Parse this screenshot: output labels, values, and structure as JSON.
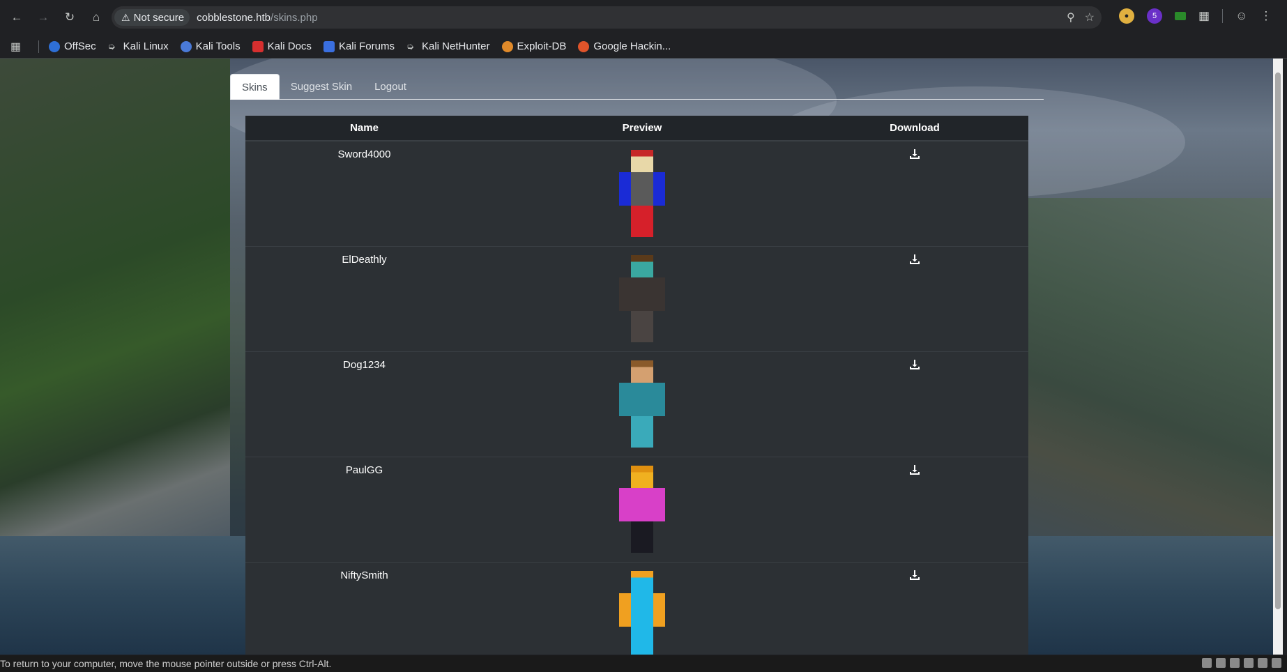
{
  "browser": {
    "security_label": "Not secure",
    "url_host": "cobblestone.htb",
    "url_path": "/skins.php",
    "extension_badge": "5"
  },
  "bookmarks": [
    {
      "label": "OffSec",
      "color": "#2e6fd6"
    },
    {
      "label": "Kali Linux",
      "color": "#c4c7c5"
    },
    {
      "label": "Kali Tools",
      "color": "#4a7ad8"
    },
    {
      "label": "Kali Docs",
      "color": "#d62f2f"
    },
    {
      "label": "Kali Forums",
      "color": "#3a6fe0"
    },
    {
      "label": "Kali NetHunter",
      "color": "#c4c7c5"
    },
    {
      "label": "Exploit-DB",
      "color": "#e08a2a"
    },
    {
      "label": "Google Hackin...",
      "color": "#e0542a"
    }
  ],
  "page": {
    "tabs": [
      {
        "label": "Skins",
        "active": true
      },
      {
        "label": "Suggest Skin",
        "active": false
      },
      {
        "label": "Logout",
        "active": false
      }
    ],
    "table": {
      "headers": {
        "name": "Name",
        "preview": "Preview",
        "download": "Download"
      },
      "rows": [
        {
          "name": "Sword4000",
          "skin": {
            "head": "#e8d8a8",
            "hat": "#c62828",
            "body": "#5a5a5a",
            "arms": "#1a2bd6",
            "legs": "#d6202a"
          }
        },
        {
          "name": "ElDeathly",
          "skin": {
            "head": "#3aa8a0",
            "hat": "#5a3a1a",
            "body": "#3a3432",
            "arms": "#3a3432",
            "legs": "#4a4442"
          }
        },
        {
          "name": "Dog1234",
          "skin": {
            "head": "#d4a070",
            "hat": "#8a5a2a",
            "body": "#2a8a9a",
            "arms": "#2a8a9a",
            "legs": "#3aaaba"
          }
        },
        {
          "name": "PaulGG",
          "skin": {
            "head": "#f0b020",
            "hat": "#e09010",
            "body": "#d840c8",
            "arms": "#d840c8",
            "legs": "#1a1a22"
          }
        },
        {
          "name": "NiftySmith",
          "skin": {
            "head": "#20b8e8",
            "hat": "#f0a020",
            "body": "#20b8e8",
            "arms": "#f0a020",
            "legs": "#20b8e8"
          }
        }
      ]
    }
  },
  "statusbar": {
    "message": "To return to your computer, move the mouse pointer outside or press Ctrl-Alt."
  }
}
